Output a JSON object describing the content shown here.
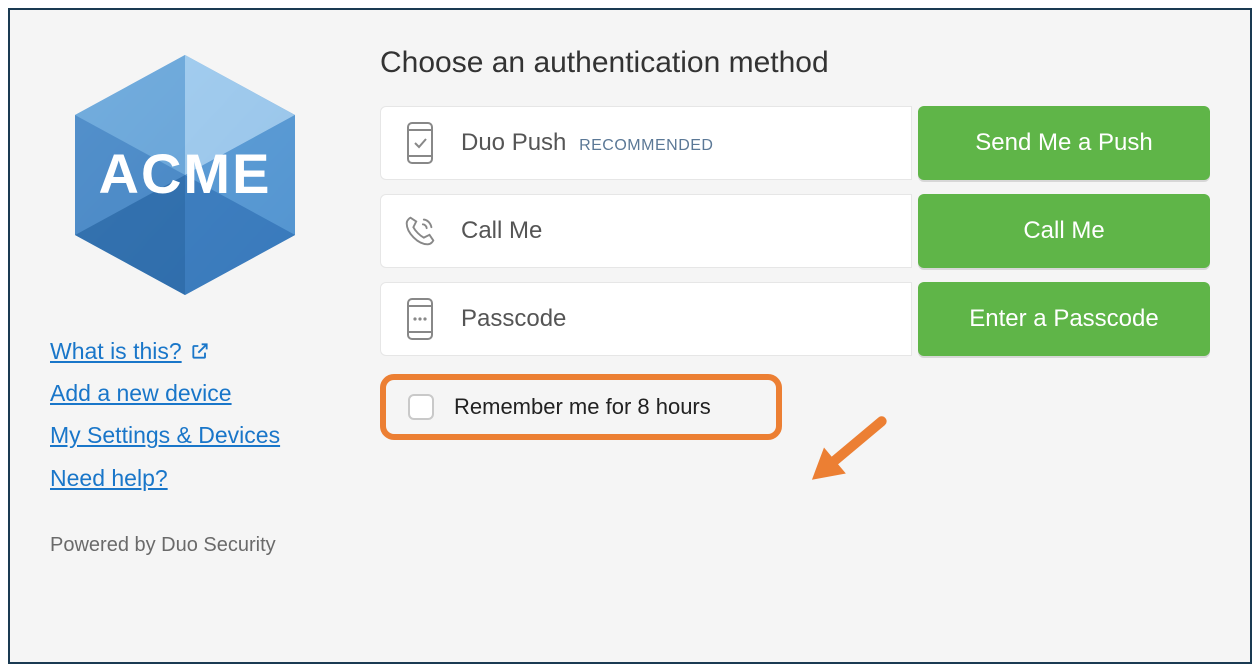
{
  "sidebar": {
    "brand": "ACME",
    "links": {
      "what_is_this": "What is this?",
      "add_device": "Add a new device",
      "settings": "My Settings & Devices",
      "help": "Need help?"
    },
    "powered": "Powered by Duo Security"
  },
  "main": {
    "heading": "Choose an authentication method",
    "methods": {
      "push": {
        "label": "Duo Push",
        "recommended": "RECOMMENDED",
        "button": "Send Me a Push"
      },
      "call": {
        "label": "Call Me",
        "button": "Call Me"
      },
      "passcode": {
        "label": "Passcode",
        "button": "Enter a Passcode"
      }
    },
    "remember": {
      "label": "Remember me for 8 hours"
    }
  },
  "colors": {
    "accent_green": "#5fb548",
    "highlight_orange": "#ec7f33",
    "link_blue": "#1976c9"
  }
}
